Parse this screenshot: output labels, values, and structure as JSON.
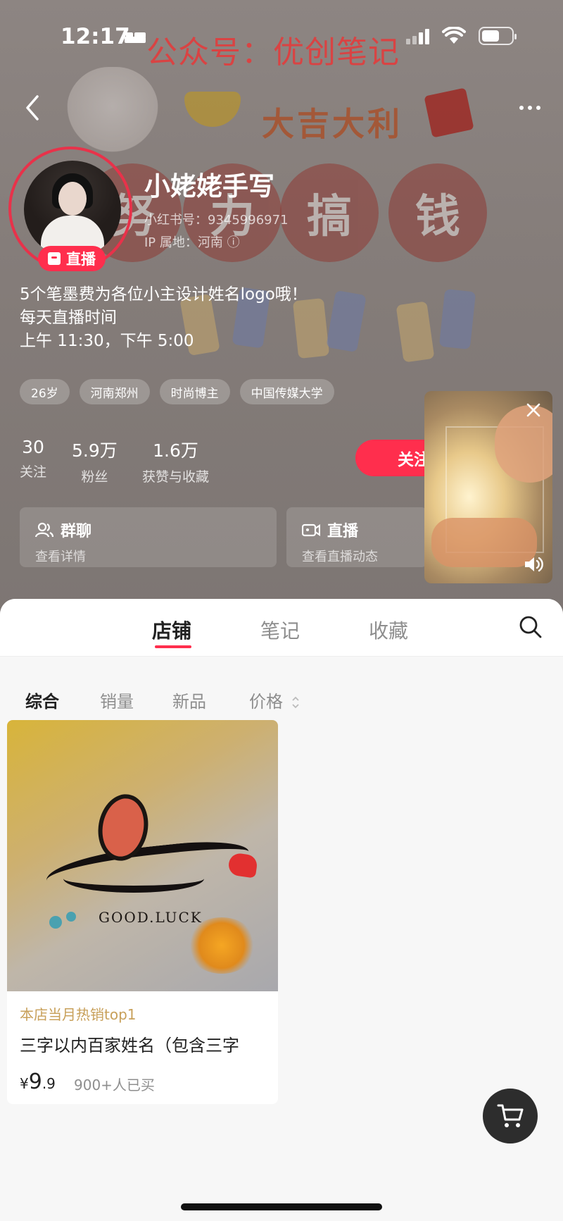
{
  "status_bar": {
    "time": "12:17",
    "watermark": "公众号：优创笔记"
  },
  "background": {
    "decor_title": "大吉大利",
    "ball_chars": [
      "努",
      "力",
      "搞",
      "钱"
    ]
  },
  "profile": {
    "nickname": "小姥姥手写",
    "red_id": "小红书号：9345996971",
    "ip_location": "IP 属地：河南 ⓘ",
    "live_badge": "直播",
    "bio_lines": [
      "5个笔墨费为各位小主设计姓名logo哦！",
      "每天直播时间",
      "上午 11:30，下午 5:00"
    ],
    "tags": [
      "26岁",
      "河南郑州",
      "时尚博主",
      "中国传媒大学"
    ],
    "stats": [
      {
        "num": "30",
        "label": "关注"
      },
      {
        "num": "5.9万",
        "label": "粉丝"
      },
      {
        "num": "1.6万",
        "label": "获赞与收藏"
      }
    ],
    "follow_label": "关注",
    "cards": [
      {
        "title": "群聊",
        "sub": "查看详情",
        "icon": "group-icon"
      },
      {
        "title": "直播",
        "sub": "查看直播动态",
        "icon": "live-icon"
      }
    ]
  },
  "tabs": [
    {
      "label": "店铺",
      "active": true
    },
    {
      "label": "笔记",
      "active": false
    },
    {
      "label": "收藏",
      "active": false
    }
  ],
  "sort_options": [
    {
      "label": "综合",
      "active": true
    },
    {
      "label": "销量",
      "active": false
    },
    {
      "label": "新品",
      "active": false
    },
    {
      "label": "价格",
      "active": false
    }
  ],
  "product": {
    "image_text": "GOOD.LUCK",
    "hot_label": "本店当月热销top1",
    "name": "三字以内百家姓名（包含三字",
    "price_symbol": "¥",
    "price_int": "9",
    "price_dec": ".9",
    "sold": "900+人已买"
  },
  "colors": {
    "accent": "#ff2e4d",
    "header_bg": "#857d7a",
    "hot_label": "#c8a05a"
  }
}
